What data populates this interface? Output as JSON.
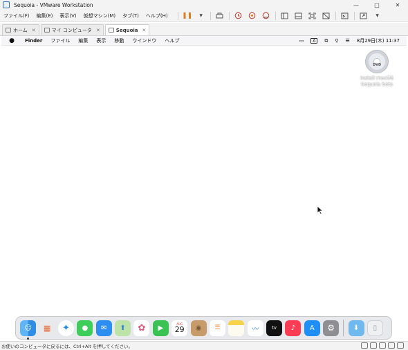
{
  "window": {
    "title": "Sequoia - VMware Workstation",
    "controls": [
      "—",
      "□",
      "✕"
    ]
  },
  "menu": [
    "ファイル(F)",
    "編集(E)",
    "表示(V)",
    "仮想マシン(M)",
    "タブ(T)",
    "ヘルプ(H)"
  ],
  "tabs": [
    {
      "label": "ホーム",
      "active": false
    },
    {
      "label": "マイ コンピュータ",
      "active": false
    },
    {
      "label": "Sequoia",
      "active": true
    }
  ],
  "mac_menubar": {
    "app": "Finder",
    "items": [
      "ファイル",
      "編集",
      "表示",
      "移動",
      "ウインドウ",
      "ヘルプ"
    ],
    "text_input_indicator": "A",
    "clock": "8月29日(木) 11:37"
  },
  "desktop_item": {
    "disc_text": "DVD",
    "label_line1": "Install macOS",
    "label_line2": "Sequoia beta"
  },
  "dock": {
    "calendar_month": "AUG",
    "calendar_day": "29"
  },
  "status_bar": {
    "text": "お使いのコンピュータに戻るには、Ctrl+Alt を押してください。"
  }
}
